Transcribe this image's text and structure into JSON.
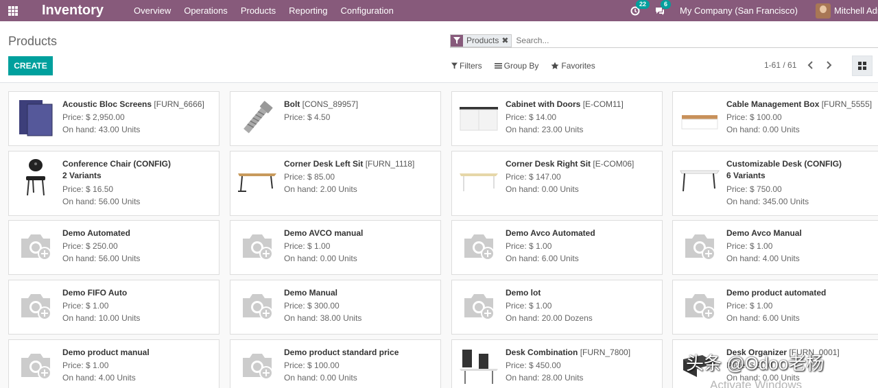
{
  "navbar": {
    "app_title": "Inventory",
    "menu": [
      "Overview",
      "Operations",
      "Products",
      "Reporting",
      "Configuration"
    ],
    "activity_count": "22",
    "message_count": "6",
    "company": "My Company (San Francisco)",
    "user": "Mitchell Admin",
    "bg_color": "#875a7b"
  },
  "control_panel": {
    "breadcrumb": "Products",
    "facet_label": "Products",
    "facet_close": "✖",
    "search_placeholder": "Search...",
    "create_label": "CREATE",
    "filters_label": "Filters",
    "group_by_label": "Group By",
    "favorites_label": "Favorites",
    "pager_value": "1-61 / 61",
    "accent_color": "#00a09d"
  },
  "products": [
    {
      "name": "Acoustic Bloc Screens",
      "ref": "[FURN_6666]",
      "variants": "",
      "price": "Price: $ 2,950.00",
      "onhand": "On hand: 43.00 Units",
      "image": "screen-image"
    },
    {
      "name": "Bolt",
      "ref": "[CONS_89957]",
      "variants": "",
      "price": "Price: $ 4.50",
      "onhand": "",
      "image": "bolt-image"
    },
    {
      "name": "Cabinet with Doors",
      "ref": "[E-COM11]",
      "variants": "",
      "price": "Price: $ 14.00",
      "onhand": "On hand: 23.00 Units",
      "image": "cabinet-image"
    },
    {
      "name": "Cable Management Box",
      "ref": "[FURN_5555]",
      "variants": "",
      "price": "Price: $ 100.00",
      "onhand": "On hand: 0.00 Units",
      "image": "cable-box-image"
    },
    {
      "name": "Conference Chair (CONFIG)",
      "ref": "",
      "variants": "2 Variants",
      "price": "Price: $ 16.50",
      "onhand": "On hand: 56.00 Units",
      "image": "chair-image"
    },
    {
      "name": "Corner Desk Left Sit",
      "ref": "[FURN_1118]",
      "variants": "",
      "price": "Price: $ 85.00",
      "onhand": "On hand: 2.00 Units",
      "image": "desk-image"
    },
    {
      "name": "Corner Desk Right Sit",
      "ref": "[E-COM06]",
      "variants": "",
      "price": "Price: $ 147.00",
      "onhand": "On hand: 0.00 Units",
      "image": "desk-white-image"
    },
    {
      "name": "Customizable Desk (CONFIG)",
      "ref": "",
      "variants": "6 Variants",
      "price": "Price: $ 750.00",
      "onhand": "On hand: 345.00 Units",
      "image": "desk-config-image"
    },
    {
      "name": "Demo Automated",
      "ref": "",
      "variants": "",
      "price": "Price: $ 250.00",
      "onhand": "On hand: 56.00 Units",
      "image": "placeholder-camera-icon"
    },
    {
      "name": "Demo AVCO manual",
      "ref": "",
      "variants": "",
      "price": "Price: $ 1.00",
      "onhand": "On hand: 0.00 Units",
      "image": "placeholder-camera-icon"
    },
    {
      "name": "Demo Avco Automated",
      "ref": "",
      "variants": "",
      "price": "Price: $ 1.00",
      "onhand": "On hand: 6.00 Units",
      "image": "placeholder-camera-icon"
    },
    {
      "name": "Demo Avco Manual",
      "ref": "",
      "variants": "",
      "price": "Price: $ 1.00",
      "onhand": "On hand: 4.00 Units",
      "image": "placeholder-camera-icon"
    },
    {
      "name": "Demo FIFO Auto",
      "ref": "",
      "variants": "",
      "price": "Price: $ 1.00",
      "onhand": "On hand: 10.00 Units",
      "image": "placeholder-camera-icon"
    },
    {
      "name": "Demo Manual",
      "ref": "",
      "variants": "",
      "price": "Price: $ 300.00",
      "onhand": "On hand: 38.00 Units",
      "image": "placeholder-camera-icon"
    },
    {
      "name": "Demo lot",
      "ref": "",
      "variants": "",
      "price": "Price: $ 1.00",
      "onhand": "On hand: 20.00 Dozens",
      "image": "placeholder-camera-icon"
    },
    {
      "name": "Demo product automated",
      "ref": "",
      "variants": "",
      "price": "Price: $ 1.00",
      "onhand": "On hand: 6.00 Units",
      "image": "placeholder-camera-icon"
    },
    {
      "name": "Demo product manual",
      "ref": "",
      "variants": "",
      "price": "Price: $ 1.00",
      "onhand": "On hand: 4.00 Units",
      "image": "placeholder-camera-icon"
    },
    {
      "name": "Demo product standard price",
      "ref": "",
      "variants": "",
      "price": "Price: $ 100.00",
      "onhand": "On hand: 0.00 Units",
      "image": "placeholder-camera-icon"
    },
    {
      "name": "Desk Combination",
      "ref": "[FURN_7800]",
      "variants": "",
      "price": "Price: $ 450.00",
      "onhand": "On hand: 28.00 Units",
      "image": "desk-combo-image"
    },
    {
      "name": "Desk Organizer",
      "ref": "[FURN_0001]",
      "variants": "",
      "price": "Price: $ 5.10",
      "onhand": "On hand: 0.00 Units",
      "image": "organizer-image"
    }
  ],
  "overlay": {
    "watermark": "头条 @Odoo老杨",
    "activate": "Activate Windows"
  }
}
